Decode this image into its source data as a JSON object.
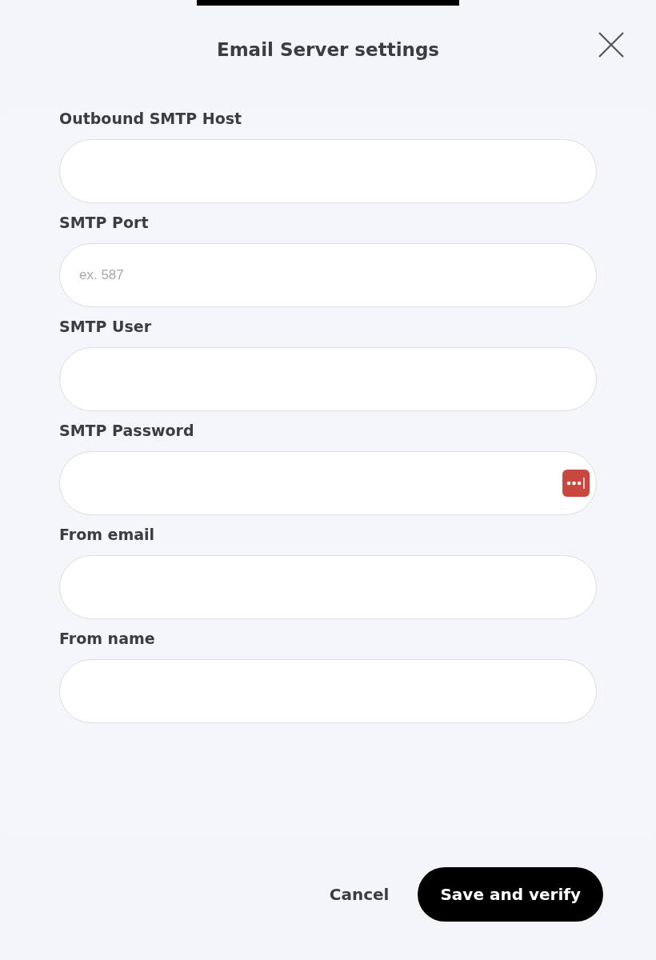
{
  "dialog": {
    "title": "Email Server settings"
  },
  "fields": [
    {
      "label": "Outbound SMTP Host",
      "kind": "text"
    },
    {
      "label": "SMTP Port",
      "kind": "text",
      "placeholder": "ex. 587"
    },
    {
      "label": "SMTP User",
      "kind": "text"
    },
    {
      "label": "SMTP Password",
      "kind": "password"
    },
    {
      "label": "From email",
      "kind": "text"
    },
    {
      "label": "From name",
      "kind": "text"
    }
  ],
  "buttons": [
    {
      "label": "Cancel",
      "kind": "secondary"
    },
    {
      "label": "Save and verify",
      "kind": "primary"
    }
  ]
}
